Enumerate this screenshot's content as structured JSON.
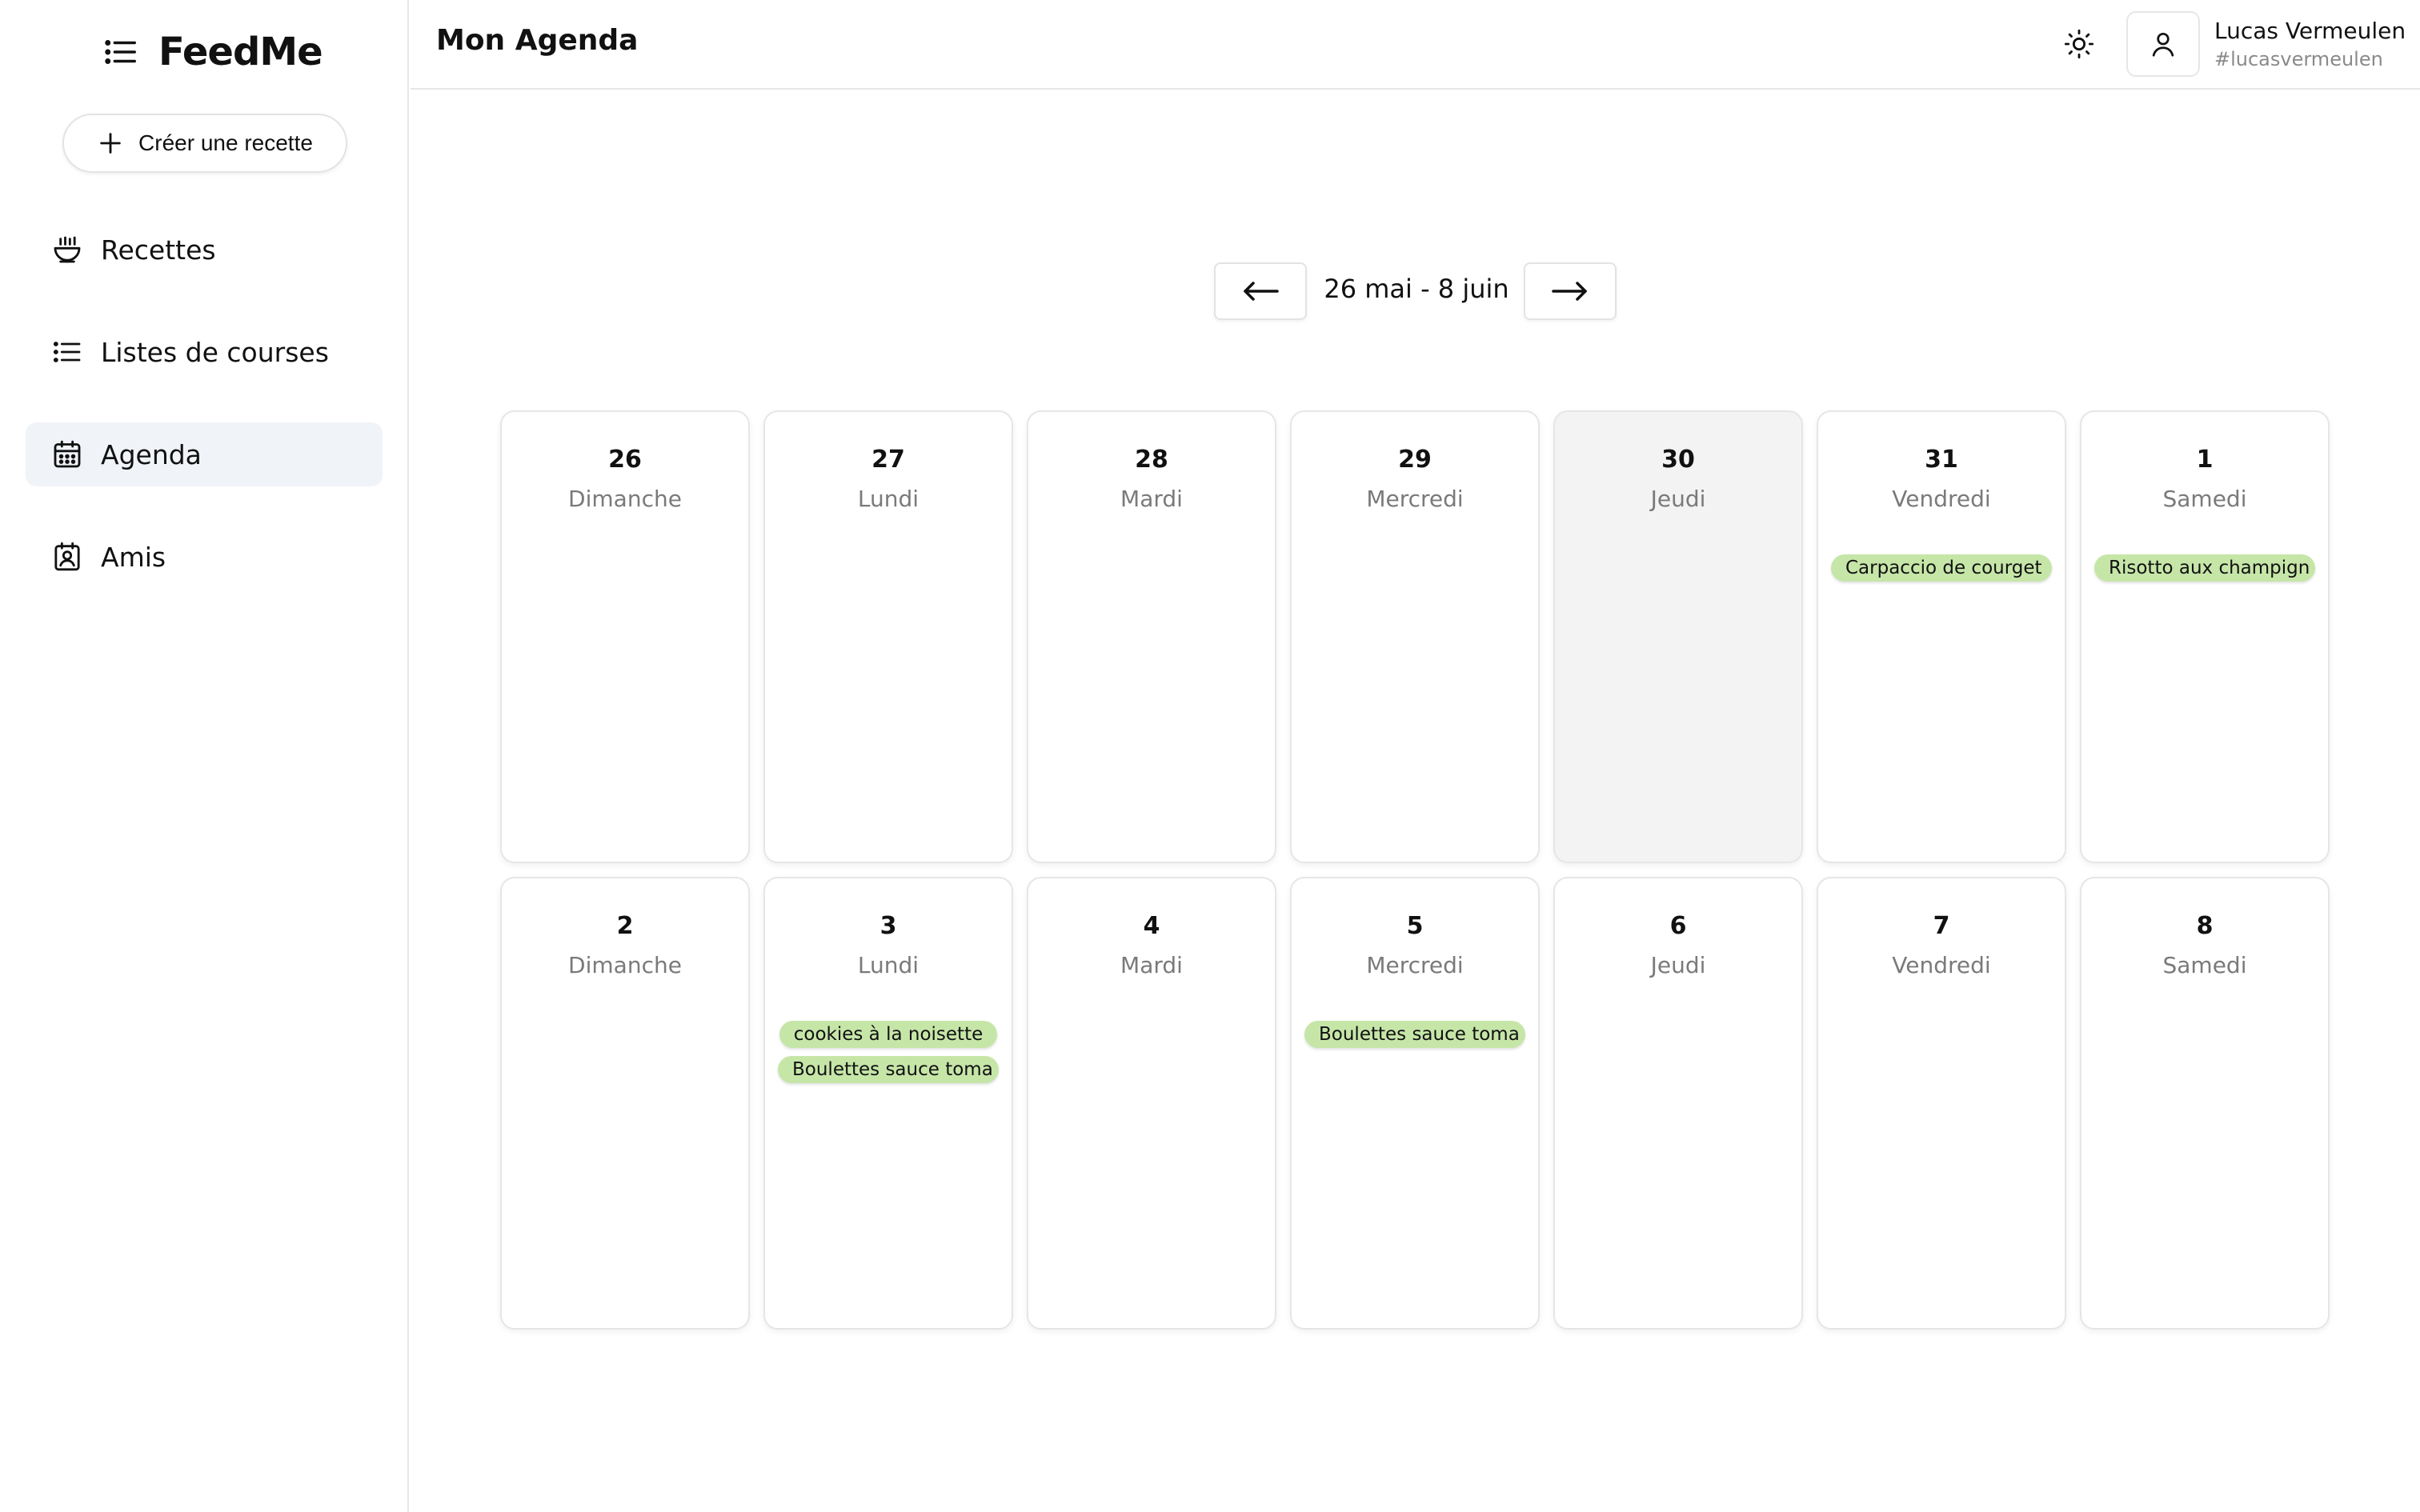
{
  "sidebar": {
    "brand": "FeedMe",
    "create_label": "Créer une recette",
    "items": [
      {
        "label": "Recettes",
        "icon": "bowl-icon"
      },
      {
        "label": "Listes de courses",
        "icon": "list-icon"
      },
      {
        "label": "Agenda",
        "icon": "calendar-icon",
        "active": true
      },
      {
        "label": "Amis",
        "icon": "contact-icon"
      }
    ]
  },
  "header": {
    "title": "Mon Agenda",
    "theme_icon": "sun-icon",
    "user": {
      "name": "Lucas Vermeulen",
      "handle": "#lucasvermeulen"
    }
  },
  "agenda": {
    "range_label": "26 mai - 8 juin",
    "weeks": [
      [
        {
          "day": "26",
          "weekday": "Dimanche",
          "meals": []
        },
        {
          "day": "27",
          "weekday": "Lundi",
          "meals": []
        },
        {
          "day": "28",
          "weekday": "Mardi",
          "meals": []
        },
        {
          "day": "29",
          "weekday": "Mercredi",
          "meals": []
        },
        {
          "day": "30",
          "weekday": "Jeudi",
          "meals": [],
          "today": true
        },
        {
          "day": "31",
          "weekday": "Vendredi",
          "meals": [
            "Carpaccio de courget"
          ]
        },
        {
          "day": "1",
          "weekday": "Samedi",
          "meals": [
            "Risotto aux champign"
          ]
        }
      ],
      [
        {
          "day": "2",
          "weekday": "Dimanche",
          "meals": []
        },
        {
          "day": "3",
          "weekday": "Lundi",
          "meals": [
            "cookies à la noisette",
            "Boulettes sauce toma"
          ]
        },
        {
          "day": "4",
          "weekday": "Mardi",
          "meals": []
        },
        {
          "day": "5",
          "weekday": "Mercredi",
          "meals": [
            "Boulettes sauce toma"
          ]
        },
        {
          "day": "6",
          "weekday": "Jeudi",
          "meals": []
        },
        {
          "day": "7",
          "weekday": "Vendredi",
          "meals": []
        },
        {
          "day": "8",
          "weekday": "Samedi",
          "meals": []
        }
      ]
    ]
  },
  "colors": {
    "meal_chip": "#c6e6a8",
    "active_nav": "#f0f3f7",
    "today_card": "#f3f3f3"
  }
}
